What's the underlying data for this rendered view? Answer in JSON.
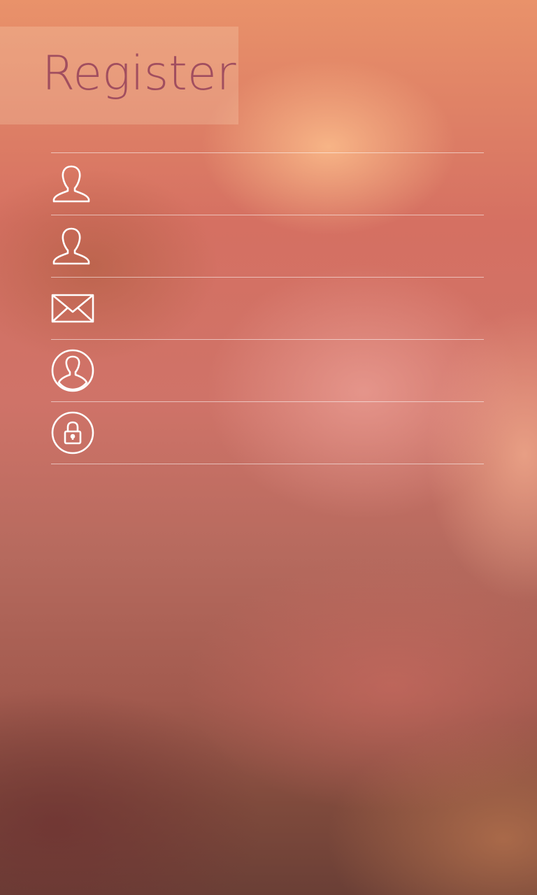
{
  "header": {
    "title": "Register"
  },
  "form": {
    "fields": [
      {
        "icon": "user-icon",
        "value": "",
        "placeholder": ""
      },
      {
        "icon": "user-icon",
        "value": "",
        "placeholder": ""
      },
      {
        "icon": "envelope-icon",
        "value": "",
        "placeholder": ""
      },
      {
        "icon": "user-circle-icon",
        "value": "",
        "placeholder": ""
      },
      {
        "icon": "lock-circle-icon",
        "value": "",
        "placeholder": ""
      }
    ]
  },
  "colors": {
    "title": "#a14e5f",
    "divider": "#ffffff",
    "icon": "#ffffff"
  }
}
